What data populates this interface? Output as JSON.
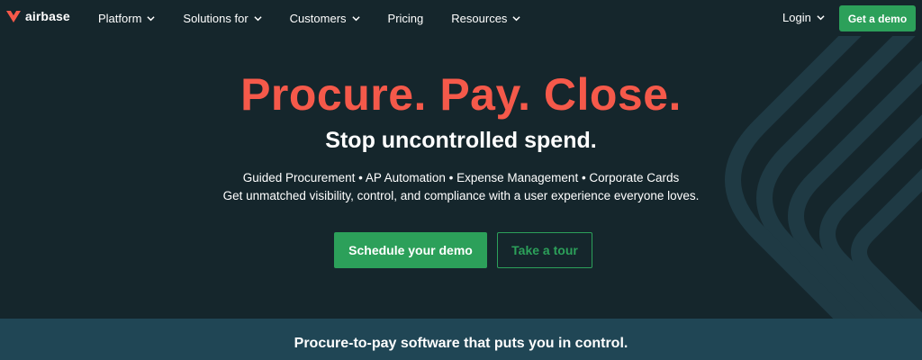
{
  "brand": {
    "name": "airbase",
    "accent": "#f5594a",
    "cta_color": "#2ca05a",
    "background": "#15262c",
    "band_color": "#204655"
  },
  "nav": {
    "items": [
      {
        "label": "Platform",
        "has_dropdown": true
      },
      {
        "label": "Solutions for",
        "has_dropdown": true
      },
      {
        "label": "Customers",
        "has_dropdown": true
      },
      {
        "label": "Pricing",
        "has_dropdown": false
      },
      {
        "label": "Resources",
        "has_dropdown": true
      }
    ],
    "login_label": "Login",
    "demo_label": "Get a demo"
  },
  "hero": {
    "title": "Procure. Pay. Close.",
    "subtitle": "Stop uncontrolled spend.",
    "features": "Guided Procurement • AP Automation • Expense Management • Corporate Cards",
    "description": "Get unmatched visibility, control, and compliance with a user experience everyone loves.",
    "primary_cta": "Schedule your demo",
    "secondary_cta": "Take a tour"
  },
  "band": {
    "text": "Procure-to-pay software that puts you in control."
  }
}
